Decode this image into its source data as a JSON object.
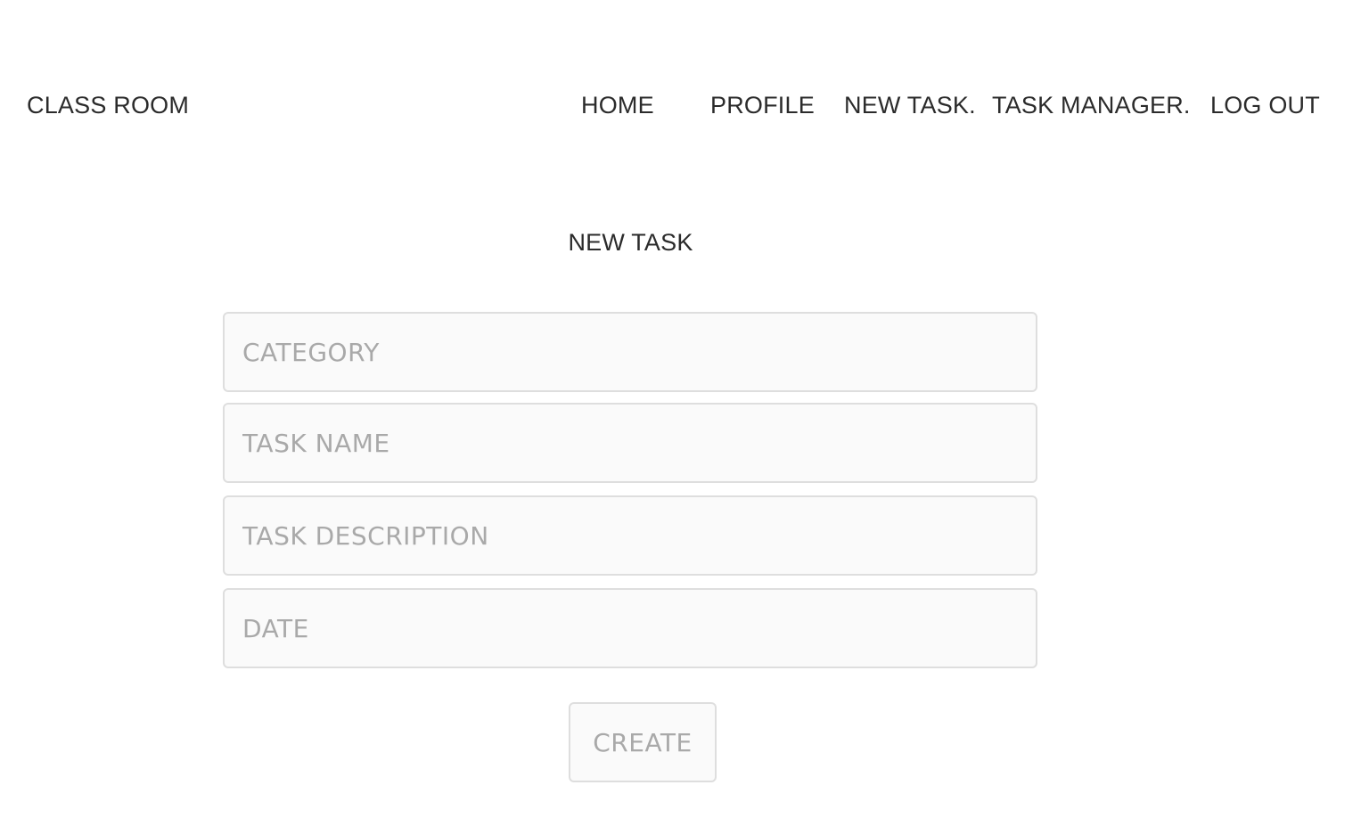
{
  "header": {
    "brand": "CLASS ROOM",
    "nav": {
      "home": "HOME",
      "profile": "PROFILE",
      "new_task": "NEW TASK.",
      "task_manager": "TASK MANAGER.",
      "log_out": "LOG OUT"
    }
  },
  "main": {
    "title": "NEW TASK",
    "form": {
      "category_placeholder": "CATEGORY",
      "task_name_placeholder": "TASK NAME",
      "task_description_placeholder": "TASK DESCRIPTION",
      "date_placeholder": "DATE",
      "create_label": "CREATE"
    }
  },
  "colors": {
    "text": "#2b2b2b",
    "field_background": "#fafafa",
    "field_border": "#dedede",
    "placeholder": "#a9a9a9"
  }
}
